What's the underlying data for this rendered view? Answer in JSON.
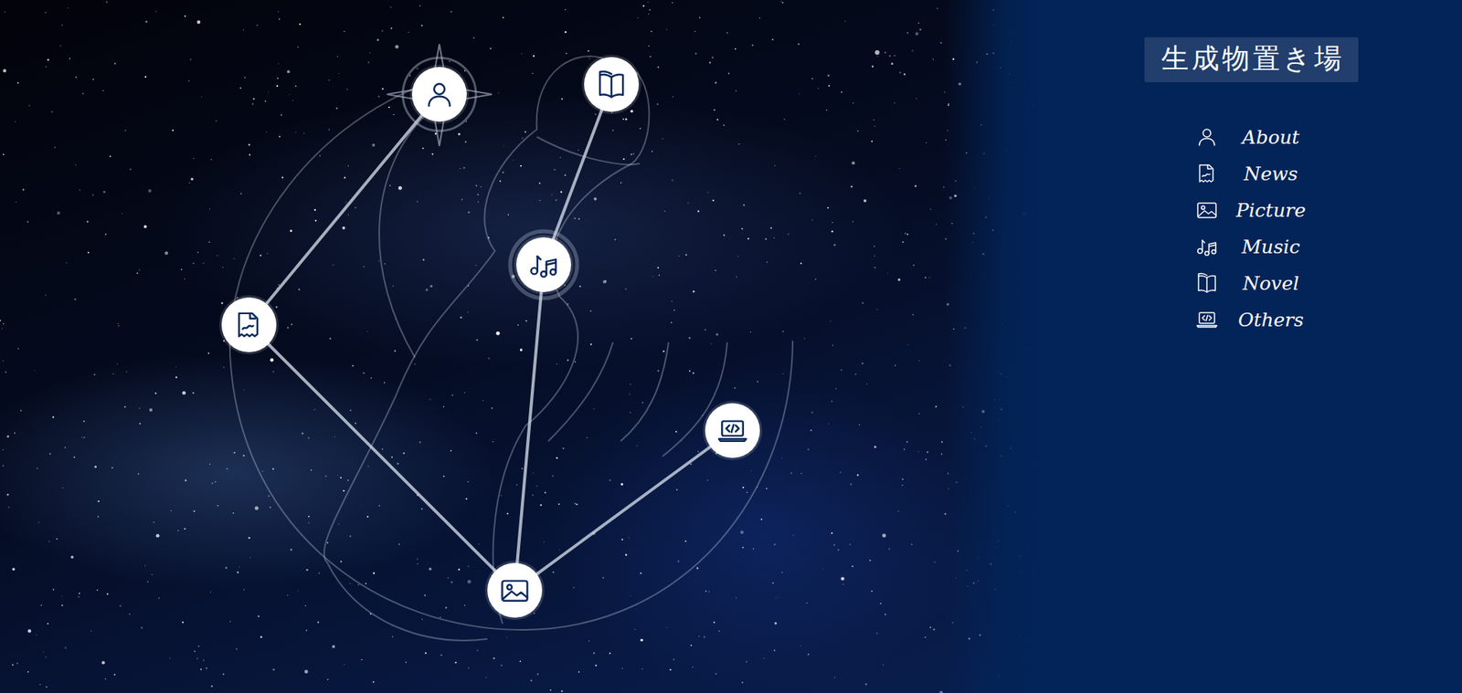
{
  "site": {
    "title": "生成物置き場"
  },
  "nav": {
    "items": [
      {
        "label": "About"
      },
      {
        "label": "News"
      },
      {
        "label": "Picture"
      },
      {
        "label": "Music"
      },
      {
        "label": "Novel"
      },
      {
        "label": "Others"
      }
    ]
  }
}
